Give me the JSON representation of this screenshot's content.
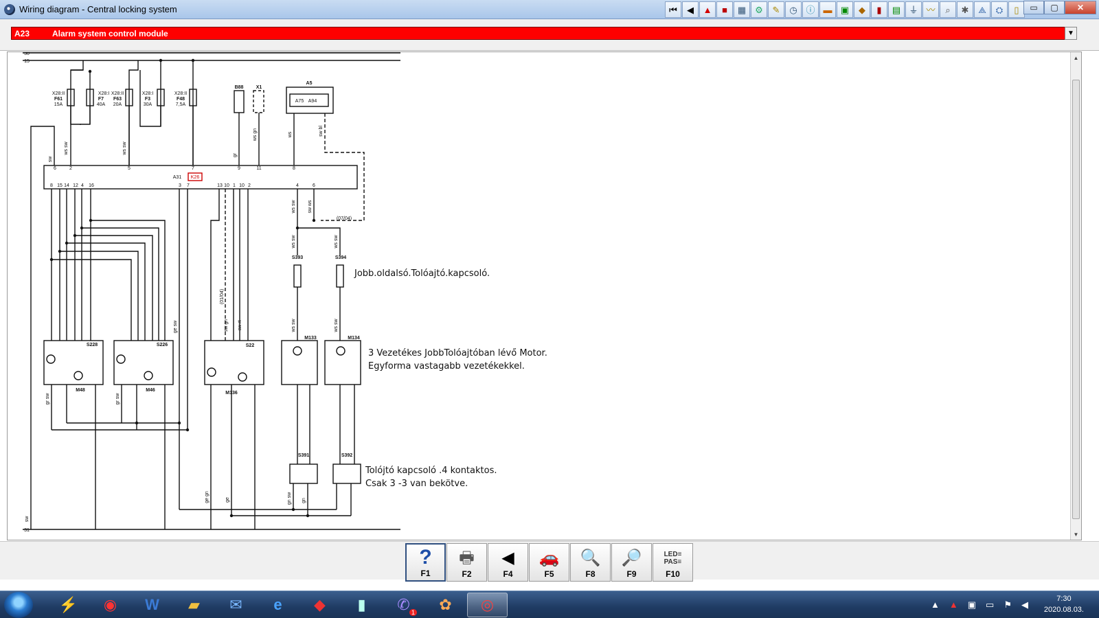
{
  "window": {
    "title": "Wiring diagram - Central locking system",
    "toolbar_icons": [
      "first-page-icon",
      "back-icon",
      "warning-icon",
      "print-icon",
      "image-icon",
      "settings-icon",
      "tool-icon",
      "clock-icon",
      "info-icon",
      "car-icon",
      "save-icon",
      "component-icon",
      "fuse-icon",
      "connector-icon",
      "ground-icon",
      "wire-icon",
      "search-icon",
      "gear-icon",
      "network-icon",
      "car-info-icon",
      "note-icon"
    ]
  },
  "selector": {
    "code": "A23",
    "name": "Alarm system control module",
    "dropdown_glyph": "▼"
  },
  "diagram": {
    "rail_labels": [
      "30",
      "15",
      "31"
    ],
    "fuses": [
      {
        "conn": "X28:II",
        "id": "F61",
        "amp": "15A"
      },
      {
        "conn": "X28:I",
        "id": "F7",
        "amp": "40A"
      },
      {
        "conn": "X28:II",
        "id": "F63",
        "amp": "20A"
      },
      {
        "conn": "X28:I",
        "id": "F3",
        "amp": "30A"
      },
      {
        "conn": "X28:II",
        "id": "F48",
        "amp": "7,5A"
      }
    ],
    "components": {
      "B88": "B88",
      "X1": "X1",
      "A5": "A5",
      "A75": "A75",
      "A94": "A94",
      "A31": "A31",
      "K26": "K26",
      "S228": "S228",
      "S226": "S226",
      "S22": "S22",
      "M48": "M48",
      "M46": "M46",
      "M136": "M136",
      "S393": "S393",
      "S394": "S394",
      "M133": "M133",
      "M134": "M134",
      "S391": "S391",
      "S392": "S392",
      "ref1": "(07/04)",
      "ref2": "(01/04)"
    },
    "module_pins_top": [
      "6",
      "2",
      "5",
      "7",
      "9",
      "11",
      "8"
    ],
    "module_pins_bottom": [
      "8",
      "15",
      "14",
      "12",
      "4",
      "16",
      "3",
      "7",
      "13",
      "10",
      "1",
      "10",
      "2",
      "4",
      "6"
    ],
    "wire_labels": {
      "sw": "sw",
      "ws_sw": "ws sw",
      "ws_gn": "ws gn",
      "gr": "gr",
      "ws": "ws",
      "sw_bl": "sw bl",
      "sw_ws": "sw ws",
      "sw_rt": "sw rt",
      "sw_gn": "sw gn",
      "ge_gn": "ge gn",
      "gr_sw": "gr sw",
      "ge_sw": "ge sw",
      "ge": "ge",
      "gn_sw": "gn sw",
      "gn": "gn"
    }
  },
  "annotations": [
    "Jobb.oldalsó.Tolóajtó.kapcsoló.",
    "3 Vezetékes JobbTolóajtóban lévő Motor.\nEgyforma vastagabb vezetékekkel.",
    "Tolójtó kapcsoló .4 kontaktos.\nCsak 3 -3 van bekötve."
  ],
  "fkeys": [
    {
      "label": "F1",
      "icon": "help-icon",
      "glyph": "?"
    },
    {
      "label": "F2",
      "icon": "printer-icon",
      "glyph": "🖶"
    },
    {
      "label": "F4",
      "icon": "back-arrow-icon",
      "glyph": "◀"
    },
    {
      "label": "F5",
      "icon": "car-icon",
      "glyph": "🚗"
    },
    {
      "label": "F8",
      "icon": "magnify-info-icon",
      "glyph": "🔍"
    },
    {
      "label": "F9",
      "icon": "magnify-tool-icon",
      "glyph": "🔎"
    },
    {
      "label": "F10",
      "icon": "led-pass-icon",
      "glyph": "LED≡\nPAS≡"
    }
  ],
  "taskbar": {
    "apps": [
      "winamp-icon",
      "chrome-icon",
      "word-icon",
      "explorer-icon",
      "thunderbird-icon",
      "ie-icon",
      "acrobat-icon",
      "notepad-icon",
      "viber-icon",
      "paint-icon",
      "diagnostic-app-icon"
    ],
    "viber_badge": "1",
    "time": "7:30",
    "date": "2020.08.03."
  }
}
